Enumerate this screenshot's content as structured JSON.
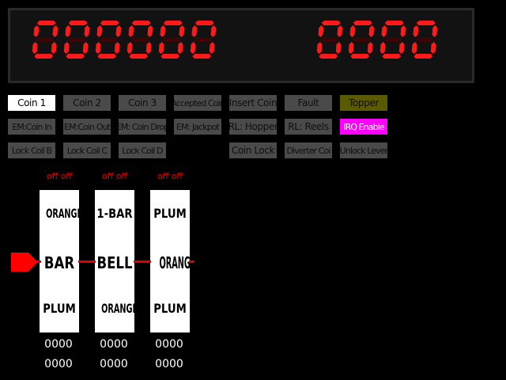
{
  "credits_display": "000000",
  "bet_display": "0000",
  "digit_color": "#ff1a1a",
  "buttons": {
    "coin1": "Coin 1",
    "coin2": "Coin 2",
    "coin3": "Coin 3",
    "accepted_coin": "Accepted Coin",
    "insert_coin": "Insert Coin",
    "fault": "Fault",
    "topper": "Topper",
    "em_coin_in": "EM:Coin In",
    "em_coin_out": "EM:Coin Out",
    "em_coin_drop": "EM: Coin Drop",
    "em_jackpot": "EM: Jackpot",
    "rl_hopper": "RL: Hopper",
    "rl_reels": "RL: Reels",
    "irq_enable": "IRQ Enable",
    "lock_coil_b": "Lock Coil B",
    "lock_coil_c": "Lock Coil C",
    "lock_coil_d": "Lock Coil D",
    "coin_lock": "Coin Lock",
    "diverter_coil": "Diverter Coi",
    "unlock_lever": "Unlock Lever"
  },
  "reels": [
    {
      "status": "off  off",
      "top": "ORANGE",
      "middle": "BAR",
      "bottom": "PLUM",
      "counter1": "0000",
      "counter2": "0000"
    },
    {
      "status": "off  off",
      "top": "1-BAR",
      "middle": "BELL",
      "bottom": "ORANGE",
      "counter1": "0000",
      "counter2": "0000"
    },
    {
      "status": "off  off",
      "top": "PLUM",
      "middle": "ORANGE",
      "bottom": "PLUM",
      "counter1": "0000",
      "counter2": "0000"
    }
  ],
  "colors": {
    "button": "#4a4a4a",
    "button_active": "#ffffff",
    "topper": "#5a5a00",
    "irq": "#ff00ff",
    "payline": "#e00000"
  }
}
